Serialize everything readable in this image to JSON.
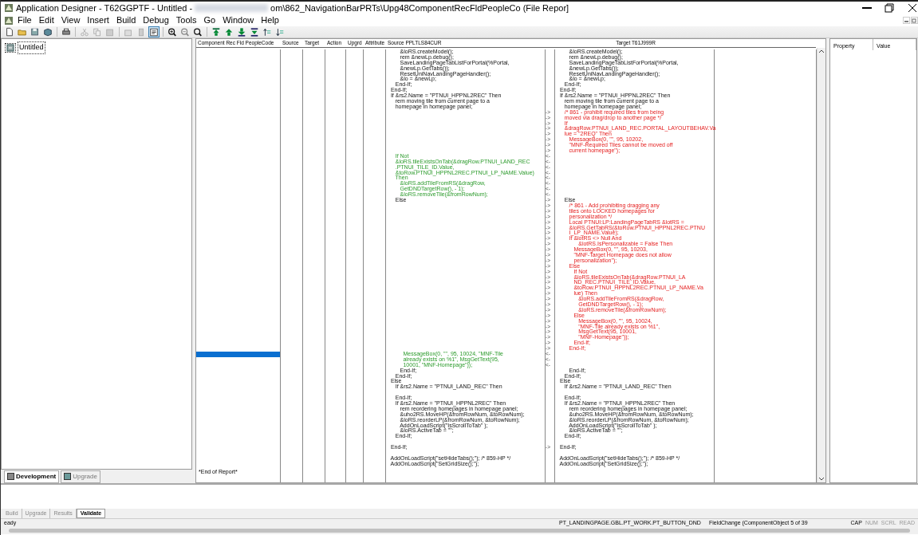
{
  "window": {
    "title_start": "Application Designer - T62GGPTF - Untitled - ",
    "title_end": "om\\862_NavigationBarPRTs\\Upg48ComponentRecFldPeopleCo (File Repor]"
  },
  "menu": [
    "File",
    "Edit",
    "View",
    "Insert",
    "Build",
    "Debug",
    "Tools",
    "Go",
    "Window",
    "Help"
  ],
  "project_tree": {
    "items": [
      {
        "label": "Untitled",
        "selected": true
      }
    ]
  },
  "project_tabs": [
    {
      "label": "Development",
      "selected": true
    },
    {
      "label": "Upgrade",
      "selected": false
    }
  ],
  "report": {
    "columns": [
      "Component Rec Fld PeopleCode",
      "Source",
      "Target",
      "Action",
      "Upgrd",
      "Attribute",
      "Source PPLTLS84CUR",
      "Target T61J999R"
    ],
    "rows": [
      {
        "kind": "same",
        "source": "        &loRS.createModel();",
        "target": "        &loRS.createModel();",
        "selected": false
      },
      {
        "kind": "same",
        "source": "        rem &newLp.debug();",
        "target": "        rem &newLp.debug();",
        "selected": false
      },
      {
        "kind": "same",
        "source": "        SaveLandingPageTabListForPortal(%Portal,",
        "target": "        SaveLandingPageTabListForPortal(%Portal,",
        "selected": false
      },
      {
        "kind": "same",
        "source": "        &newLp.GetTabs());",
        "target": "        &newLp.GetTabs());",
        "selected": false
      },
      {
        "kind": "same",
        "source": "        ResetUniNavLandingPageHandler();",
        "target": "        ResetUniNavLandingPageHandler();",
        "selected": false
      },
      {
        "kind": "same",
        "source": "        &lo = &newLp;",
        "target": "        &lo = &newLp;",
        "selected": false
      },
      {
        "kind": "same",
        "source": "     End-If;",
        "target": "     End-If;",
        "selected": false
      },
      {
        "kind": "same",
        "source": "  End-If;",
        "target": "  End-If;",
        "selected": false
      },
      {
        "kind": "same",
        "source": "  If &rs2.Name = \"PTNUI_HPPNL2REC\" Then",
        "target": "  If &rs2.Name = \"PTNUI_HPPNL2REC\" Then",
        "selected": false
      },
      {
        "kind": "same",
        "source": "     rem moving tile from current page to a",
        "target": "     rem moving tile from current page to a",
        "selected": false
      },
      {
        "kind": "same",
        "source": "     homepage in homepage panel;",
        "target": "     homepage in homepage panel;",
        "selected": false
      },
      {
        "kind": "target",
        "marker": "->",
        "target": "     /* 861 - prohibit required tiles from being",
        "selected": false
      },
      {
        "kind": "target",
        "marker": "->",
        "target": "     moved via drag/drop to another page */",
        "selected": false
      },
      {
        "kind": "target",
        "marker": "->",
        "target": "     If",
        "selected": false
      },
      {
        "kind": "target",
        "marker": "->",
        "target": "     &dragRow.PTNUI_LAND_REC.PORTAL_LAYOUTBEHAV.Va",
        "selected": false
      },
      {
        "kind": "target",
        "marker": "->",
        "target": "     lue = \"2REQ\" Then",
        "selected": false
      },
      {
        "kind": "target",
        "marker": "->",
        "target": "        MessageBox(0, \"\", 95, 10202,",
        "selected": false
      },
      {
        "kind": "target",
        "marker": "->",
        "target": "        \"MNF-Required Tiles cannot be moved off",
        "selected": false
      },
      {
        "kind": "target",
        "marker": "->",
        "target": "        current homepage\");",
        "selected": false
      },
      {
        "kind": "source",
        "marker": "<-",
        "source": "     If Not",
        "selected": false
      },
      {
        "kind": "source",
        "marker": "<-",
        "source": "     &loRS.tileExistsOnTab(&dragRow.PTNUI_LAND_REC",
        "selected": false
      },
      {
        "kind": "source",
        "marker": "<-",
        "source": "     .PTNUI_TILE_ID.Value,",
        "selected": false
      },
      {
        "kind": "source",
        "marker": "<-",
        "source": "     &toRow.PTNUI_HPPNL2REC.PTNUI_LP_NAME.Value)",
        "selected": false
      },
      {
        "kind": "source",
        "marker": "<-",
        "source": "     Then",
        "selected": false
      },
      {
        "kind": "source",
        "marker": "<-",
        "source": "        &loRS.addTileFromRS(&dragRow,",
        "selected": false
      },
      {
        "kind": "source",
        "marker": "<-",
        "source": "        GetDNDTargetRow(), - 1);",
        "selected": false
      },
      {
        "kind": "source",
        "marker": "<-",
        "source": "        &loRS.removeTile(&fromRowNum);",
        "selected": false
      },
      {
        "kind": "same",
        "marker": "->",
        "source": "     Else",
        "target": "     Else",
        "selected": false
      },
      {
        "kind": "target",
        "marker": "->",
        "target": "        /* 861 - Add prohibiting dragging any",
        "selected": false
      },
      {
        "kind": "target",
        "marker": "->",
        "target": "        tiles onto LOCKED homepages for",
        "selected": false
      },
      {
        "kind": "target",
        "marker": "->",
        "target": "        personalization */",
        "selected": false
      },
      {
        "kind": "target",
        "marker": "->",
        "target": "        Local PTNUI:LP:LandingPageTabRS &lotRS =",
        "selected": false
      },
      {
        "kind": "target",
        "marker": "->",
        "target": "        &loRS.GetTabRS(&toRow.PTNUI_HPPNL2REC.PTNU",
        "selected": false
      },
      {
        "kind": "target",
        "marker": "->",
        "target": "        I_LP_NAME.Value);",
        "selected": false
      },
      {
        "kind": "target",
        "marker": "->",
        "target": "        If &lotRS <> Null And",
        "selected": false
      },
      {
        "kind": "target",
        "marker": "->",
        "target": "              &lotRS.IsPersonalizable = False Then",
        "selected": false
      },
      {
        "kind": "target",
        "marker": "->",
        "target": "           MessageBox(0, \"\", 95, 10203,",
        "selected": false
      },
      {
        "kind": "target",
        "marker": "->",
        "target": "           \"MNF-Target Homepage does not allow",
        "selected": false
      },
      {
        "kind": "target",
        "marker": "->",
        "target": "           personalization\");",
        "selected": false
      },
      {
        "kind": "target",
        "marker": "->",
        "target": "        Else",
        "selected": false
      },
      {
        "kind": "target",
        "marker": "->",
        "target": "           If Not",
        "selected": false
      },
      {
        "kind": "target",
        "marker": "->",
        "target": "           &loRS.tileExistsOnTab(&dragRow.PTNUI_LA",
        "selected": false
      },
      {
        "kind": "target",
        "marker": "->",
        "target": "           ND_REC.PTNUI_TILE_ID.Value,",
        "selected": false
      },
      {
        "kind": "target",
        "marker": "->",
        "target": "           &toRow.PTNUI_HPPNL2REC.PTNUI_LP_NAME.Va",
        "selected": false
      },
      {
        "kind": "target",
        "marker": "->",
        "target": "           lue) Then",
        "selected": false
      },
      {
        "kind": "target",
        "marker": "->",
        "target": "              &loRS.addTileFromRS(&dragRow,",
        "selected": false
      },
      {
        "kind": "target",
        "marker": "->",
        "target": "              GetDNDTargetRow(), - 1);",
        "selected": false
      },
      {
        "kind": "target",
        "marker": "->",
        "target": "              &loRS.removeTile(&fromRowNum);",
        "selected": false
      },
      {
        "kind": "target",
        "marker": "->",
        "target": "           Else",
        "selected": false
      },
      {
        "kind": "target",
        "marker": "->",
        "target": "              MessageBox(0, \"\", 95, 10024,",
        "selected": false
      },
      {
        "kind": "target",
        "marker": "->",
        "target": "              \"MNF-Tile already exists on %1\",",
        "selected": false
      },
      {
        "kind": "target",
        "marker": "->",
        "target": "              MsgGetText(95, 10001,",
        "selected": false
      },
      {
        "kind": "target",
        "marker": "->",
        "target": "              \"MNF-Homepage\"));",
        "selected": false
      },
      {
        "kind": "target",
        "marker": "->",
        "target": "           End-If;",
        "selected": false
      },
      {
        "kind": "target",
        "marker": "->",
        "target": "        End-If;",
        "selected": false
      },
      {
        "kind": "source",
        "marker": "<-",
        "source": "          MessageBox(0, \"\", 95, 10024, \"MNF-Tile",
        "selected": true
      },
      {
        "kind": "source",
        "marker": "<-",
        "source": "          already exists on %1\", MsgGetText(95,",
        "selected": false
      },
      {
        "kind": "source",
        "marker": "<-",
        "source": "          10001, \"MNF-Homepage\"));",
        "selected": false
      },
      {
        "kind": "same",
        "source": "        End-If;",
        "target": "        End-If;",
        "selected": false
      },
      {
        "kind": "same",
        "source": "     End-If;",
        "target": "     End-If;",
        "selected": false
      },
      {
        "kind": "same",
        "source": "  Else",
        "target": "  Else",
        "selected": false
      },
      {
        "kind": "same",
        "source": "     If &rs2.Name = \"PTNUI_LAND_REC\" Then",
        "target": "     If &rs2.Name = \"PTNUI_LAND_REC\" Then",
        "selected": false
      },
      {
        "kind": "same",
        "selected": false
      },
      {
        "kind": "same",
        "source": "     End-If;",
        "target": "     End-If;",
        "selected": false
      },
      {
        "kind": "same",
        "source": "     If &rs2.Name = \"PTNUI_HPPNL2REC\" Then",
        "target": "     If &rs2.Name = \"PTNUI_HPPNL2REC\" Then",
        "selected": false
      },
      {
        "kind": "same",
        "source": "        rem reordering homepages in homepage panel;",
        "target": "        rem reordering homepages in homepage panel;",
        "selected": false
      },
      {
        "kind": "same",
        "source": "        &uho2RS.MoveHP(&fromRowNum, &toRowNum);",
        "target": "        &uho2RS.MoveHP(&fromRowNum, &toRowNum);",
        "selected": false
      },
      {
        "kind": "same",
        "source": "        &loRS.reorderLP(&fromRowNum, &toRowNum);",
        "target": "        &loRS.reorderLP(&fromRowNum, &toRowNum);",
        "selected": false
      },
      {
        "kind": "same",
        "source": "        AddOnLoadScript(\"IsScrollToTab\" );",
        "target": "        AddOnLoadScript(\"IsScrollToTab\" );",
        "selected": false
      },
      {
        "kind": "same",
        "source": "        &loRS.ActiveTab = \"\";",
        "target": "        &loRS.ActiveTab = \"\";",
        "selected": false
      },
      {
        "kind": "same",
        "source": "     End-If;",
        "target": "     End-If;",
        "selected": false
      },
      {
        "kind": "same",
        "selected": false
      },
      {
        "kind": "same",
        "marker": "->",
        "source": "  End-If;",
        "target": "  End-If;",
        "selected": false
      },
      {
        "kind": "same",
        "selected": false
      },
      {
        "kind": "same",
        "source": "  AddOnLoadScript(\"setHideTabs();\"); /* 859-HP */",
        "target": "  AddOnLoadScript(\"setHideTabs();\"); /* 859-HP */",
        "selected": false
      },
      {
        "kind": "same",
        "source": "  AddOnLoadScript(\"SetGridSize();\");",
        "target": "  AddOnLoadScript(\"SetGridSize();\");",
        "selected": false
      }
    ],
    "footer": "*End of Report*"
  },
  "properties": {
    "columns": [
      "Property",
      "Value"
    ]
  },
  "output_tabs": [
    {
      "label": "Build",
      "selected": false
    },
    {
      "label": "Upgrade",
      "selected": false
    },
    {
      "label": "Results",
      "selected": false
    },
    {
      "label": "Validate",
      "selected": true
    }
  ],
  "status_bar": {
    "message": "eady",
    "object": "PT_LANDINGPAGE.GBL.PT_WORK.PT_BUTTON_DND",
    "event": "FieldChange (ComponentObject 5 of 39",
    "indicators": [
      "CAP",
      "NUM",
      "SCRL",
      "READ"
    ]
  }
}
